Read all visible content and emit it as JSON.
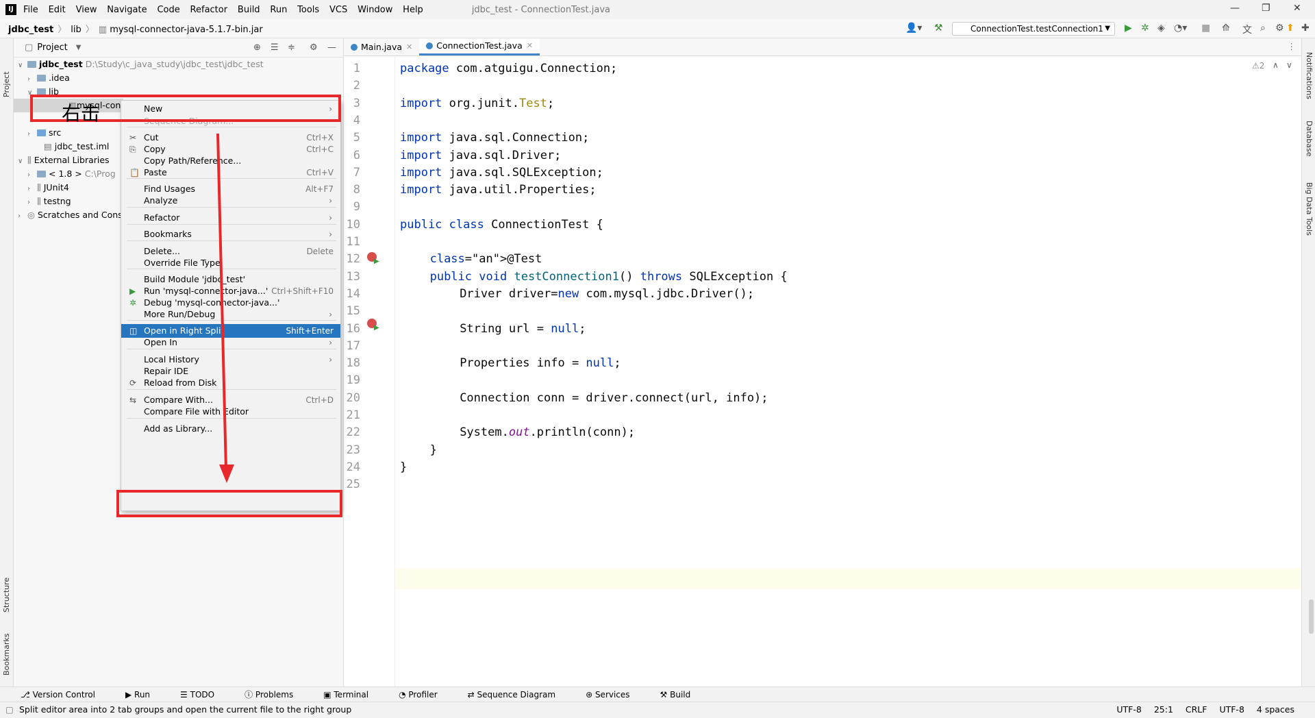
{
  "titlebar": {
    "menu": [
      "File",
      "Edit",
      "View",
      "Navigate",
      "Code",
      "Refactor",
      "Build",
      "Run",
      "Tools",
      "VCS",
      "Window",
      "Help"
    ],
    "window_title": "jdbc_test - ConnectionTest.java"
  },
  "navbar": {
    "project": "jdbc_test",
    "folder": "lib",
    "file": "mysql-connector-java-5.1.7-bin.jar",
    "run_config": "ConnectionTest.testConnection1"
  },
  "stripes": {
    "left_top": "Project",
    "left_structure": "Structure",
    "left_bookmarks": "Bookmarks",
    "right": [
      "Notifications",
      "Database",
      "Big Data Tools"
    ]
  },
  "project_panel": {
    "title": "Project",
    "tree": [
      {
        "label": "jdbc_test",
        "extra": "D:\\Study\\c_java_study\\jdbc_test\\jdbc_test"
      },
      {
        "label": ".idea"
      },
      {
        "label": "lib"
      },
      {
        "label": "mysql-connec"
      },
      {
        "label": "src"
      },
      {
        "label": "jdbc_test.iml"
      },
      {
        "label": "External Libraries"
      },
      {
        "label": "< 1.8 >",
        "extra": "C:\\Prog"
      },
      {
        "label": "JUnit4"
      },
      {
        "label": "testng"
      },
      {
        "label": "Scratches and Cons"
      }
    ]
  },
  "tabs": [
    {
      "label": "Main.java"
    },
    {
      "label": "ConnectionTest.java"
    }
  ],
  "editor": {
    "warnings": "⚠2",
    "lines": [
      {
        "n": "1",
        "text": "package com.atguigu.Connection;"
      },
      {
        "n": "2",
        "text": ""
      },
      {
        "n": "3",
        "text": "import org.junit.Test;"
      },
      {
        "n": "4",
        "text": ""
      },
      {
        "n": "5",
        "text": "import java.sql.Connection;"
      },
      {
        "n": "6",
        "text": "import java.sql.Driver;"
      },
      {
        "n": "7",
        "text": "import java.sql.SQLException;"
      },
      {
        "n": "8",
        "text": "import java.util.Properties;"
      },
      {
        "n": "9",
        "text": ""
      },
      {
        "n": "10",
        "text": "public class ConnectionTest {"
      },
      {
        "n": "11",
        "text": ""
      },
      {
        "n": "12",
        "text": "@Test"
      },
      {
        "n": "13",
        "text": "public void testConnection1() throws SQLException {"
      },
      {
        "n": "14",
        "text": "Driver driver=new com.mysql.jdbc.Driver();"
      },
      {
        "n": "15",
        "text": ""
      },
      {
        "n": "16",
        "text": "String url = null;"
      },
      {
        "n": "17",
        "text": ""
      },
      {
        "n": "18",
        "text": "Properties info = null;"
      },
      {
        "n": "19",
        "text": ""
      },
      {
        "n": "20",
        "text": "Connection conn = driver.connect(url, info);"
      },
      {
        "n": "21",
        "text": ""
      },
      {
        "n": "22",
        "text": "System.out.println(conn);"
      },
      {
        "n": "23",
        "text": "}"
      },
      {
        "n": "24",
        "text": "}"
      },
      {
        "n": "25",
        "text": ""
      }
    ]
  },
  "context_menu": {
    "items": [
      {
        "label": "New",
        "shortcut": "",
        "submenu": true
      },
      {
        "label": "Sequence Diagram...",
        "disabled": true
      },
      {
        "label": "Cut",
        "shortcut": "Ctrl+X"
      },
      {
        "label": "Copy",
        "shortcut": "Ctrl+C"
      },
      {
        "label": "Copy Path/Reference...",
        "shortcut": ""
      },
      {
        "label": "Paste",
        "shortcut": "Ctrl+V"
      },
      {
        "label": "Find Usages",
        "shortcut": "Alt+F7"
      },
      {
        "label": "Analyze",
        "submenu": true
      },
      {
        "label": "Refactor",
        "submenu": true
      },
      {
        "label": "Bookmarks",
        "submenu": true
      },
      {
        "label": "Delete...",
        "shortcut": "Delete"
      },
      {
        "label": "Override File Type",
        "shortcut": ""
      },
      {
        "label": "Build Module 'jdbc_test'",
        "shortcut": ""
      },
      {
        "label": "Run 'mysql-connector-java...'",
        "shortcut": "Ctrl+Shift+F10"
      },
      {
        "label": "Debug 'mysql-connector-java...'",
        "shortcut": ""
      },
      {
        "label": "More Run/Debug",
        "submenu": true
      },
      {
        "label": "Open in Right Split",
        "shortcut": "Shift+Enter",
        "selected": true
      },
      {
        "label": "Open In",
        "submenu": true
      },
      {
        "label": "Local History",
        "submenu": true
      },
      {
        "label": "Repair IDE",
        "shortcut": ""
      },
      {
        "label": "Reload from Disk",
        "shortcut": ""
      },
      {
        "label": "Compare With...",
        "shortcut": "Ctrl+D"
      },
      {
        "label": "Compare File with Editor",
        "shortcut": ""
      },
      {
        "label": "Add as Library...",
        "shortcut": ""
      }
    ]
  },
  "annotation": {
    "text": "右击"
  },
  "bottom_tools": [
    "Version Control",
    "Run",
    "TODO",
    "Problems",
    "Terminal",
    "Profiler",
    "Sequence Diagram",
    "Services",
    "Build"
  ],
  "statusbar": {
    "message": "Split editor area into 2 tab groups and open the current file to the right group",
    "encoding1": "UTF-8",
    "position": "25:1",
    "line_sep": "CRLF",
    "encoding2": "UTF-8",
    "indent": "4 spaces"
  }
}
